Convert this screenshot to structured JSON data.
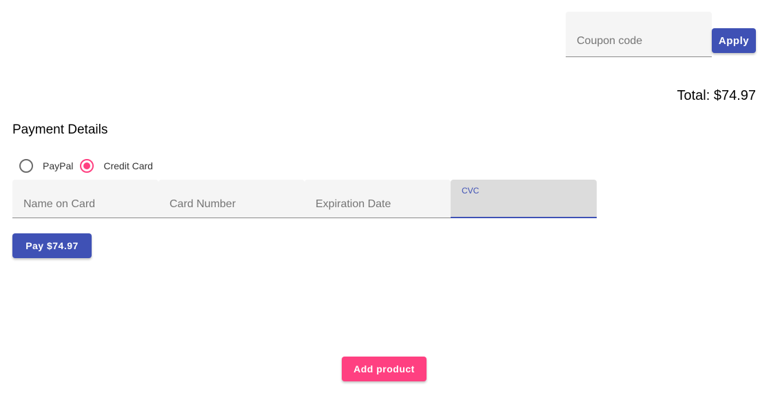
{
  "coupon": {
    "placeholder": "Coupon code",
    "value": "",
    "apply_label": "Apply"
  },
  "total": {
    "label": "Total: $74.97"
  },
  "payment": {
    "title": "Payment Details",
    "methods": [
      {
        "label": "PayPal",
        "selected": false
      },
      {
        "label": "Credit Card",
        "selected": true
      }
    ],
    "fields": {
      "name_placeholder": "Name on Card",
      "number_placeholder": "Card Number",
      "expiry_placeholder": "Expiration Date",
      "cvc_label": "CVC"
    },
    "pay_label": "Pay $74.97"
  },
  "footer": {
    "add_product_label": "Add product"
  },
  "colors": {
    "primary": "#3f51b5",
    "accent": "#ff4081"
  }
}
